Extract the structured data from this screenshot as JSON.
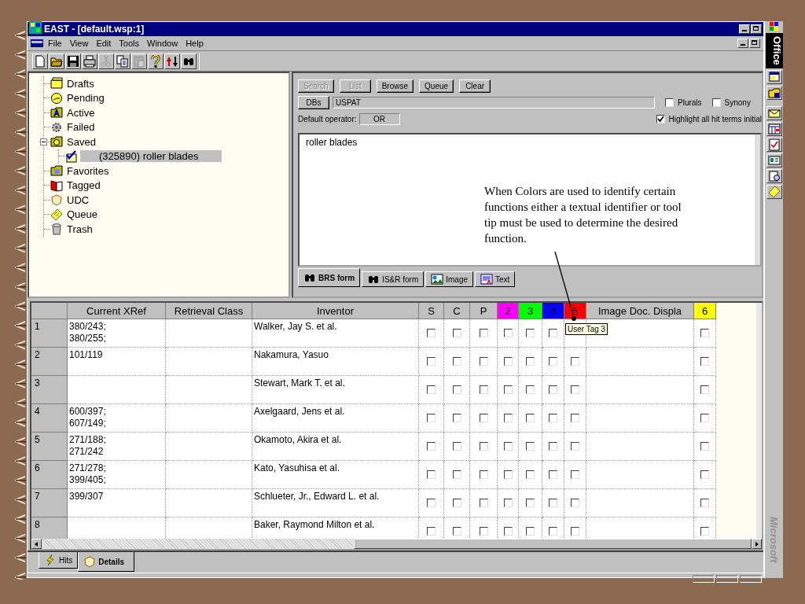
{
  "window": {
    "title": "EAST - [default.wsp:1]"
  },
  "menu": [
    "File",
    "View",
    "Edit",
    "Tools",
    "Window",
    "Help"
  ],
  "toolbar": [
    {
      "kind": "new",
      "disabled": false
    },
    {
      "kind": "open",
      "disabled": false
    },
    {
      "kind": "save",
      "disabled": false
    },
    {
      "kind": "print",
      "disabled": false
    },
    {
      "kind": "cut",
      "disabled": true
    },
    {
      "kind": "copy",
      "disabled": false
    },
    {
      "kind": "paste",
      "disabled": true
    },
    {
      "kind": "help",
      "disabled": false
    },
    {
      "kind": "sort",
      "disabled": false
    },
    {
      "kind": "find",
      "disabled": false
    }
  ],
  "tree": [
    {
      "label": "Drafts",
      "kind": "drafts",
      "selected": false
    },
    {
      "label": "Pending",
      "kind": "pending",
      "selected": false
    },
    {
      "label": "Active",
      "kind": "active",
      "selected": false
    },
    {
      "label": "Failed",
      "kind": "failed",
      "selected": false
    },
    {
      "label": "Saved",
      "kind": "saved",
      "selected": false,
      "expanded": true,
      "children": [
        {
          "label": "(325890) roller blades",
          "kind": "query",
          "selected": true
        }
      ]
    },
    {
      "label": "Favorites",
      "kind": "favorites",
      "selected": false
    },
    {
      "label": "Tagged",
      "kind": "tagged",
      "selected": false
    },
    {
      "label": "UDC",
      "kind": "udc",
      "selected": false
    },
    {
      "label": "Queue",
      "kind": "queue",
      "selected": false
    },
    {
      "label": "Trash",
      "kind": "trash",
      "selected": false
    }
  ],
  "query": {
    "buttons": [
      {
        "label": "Search",
        "disabled": true
      },
      {
        "label": "List",
        "disabled": true
      },
      {
        "label": "Browse",
        "disabled": false
      },
      {
        "label": "Queue",
        "disabled": false
      },
      {
        "label": "Clear",
        "disabled": false
      }
    ],
    "dbs_button": "DBs",
    "dbs_value": "USPAT",
    "options": [
      {
        "label": "Plurals",
        "checked": false
      },
      {
        "label": "Synony",
        "checked": false
      },
      {
        "label": "Highlight all hit terms initial",
        "checked": true
      }
    ],
    "operator_label": "Default operator:",
    "operator_value": "OR",
    "text": "roller blades",
    "tabs": [
      {
        "label": "BRS form",
        "kind": "binoculars",
        "selected": true
      },
      {
        "label": "IS&R form",
        "kind": "binoculars",
        "selected": false
      },
      {
        "label": "Image",
        "kind": "image",
        "selected": false
      },
      {
        "label": "Text",
        "kind": "text",
        "selected": false
      }
    ]
  },
  "annotation": {
    "text": "When Colors are used to identify certain functions either a textual identifier or tool tip must be used to determine the desired function."
  },
  "table": {
    "columns": [
      {
        "label": "Current XRef",
        "kind": "text"
      },
      {
        "label": "Retrieval Class",
        "kind": "text"
      },
      {
        "label": "Inventor",
        "kind": "text"
      },
      {
        "label": "S",
        "kind": "check"
      },
      {
        "label": "C",
        "kind": "check"
      },
      {
        "label": "P",
        "kind": "check"
      },
      {
        "label": "2",
        "kind": "check",
        "color": "#ff00ff"
      },
      {
        "label": "3",
        "kind": "check",
        "color": "#00ff00"
      },
      {
        "label": "4",
        "kind": "check",
        "color": "#0000ff"
      },
      {
        "label": "5",
        "kind": "check",
        "color": "#ff0000"
      },
      {
        "label": "Image Doc. Displa",
        "kind": "text"
      },
      {
        "label": "6",
        "kind": "check",
        "color": "#ffff00"
      }
    ],
    "rows": [
      {
        "number": "1",
        "cells": [
          "380/243;\n380/255;",
          null,
          "Walker, Jay S. et al.",
          {
            "checked": false
          },
          {
            "checked": false
          },
          {
            "checked": false
          },
          {
            "checked": false
          },
          {
            "checked": false
          },
          {
            "checked": false
          },
          null,
          null,
          {
            "checked": false
          }
        ]
      },
      {
        "number": "2",
        "cells": [
          "101/119",
          null,
          "Nakamura, Yasuo",
          {
            "checked": false
          },
          {
            "checked": false
          },
          {
            "checked": false
          },
          {
            "checked": false
          },
          {
            "checked": false
          },
          {
            "checked": false
          },
          {
            "checked": false
          },
          null,
          {
            "checked": false
          }
        ]
      },
      {
        "number": "3",
        "cells": [
          null,
          null,
          "Stewart, Mark T. et al.",
          {
            "checked": false
          },
          {
            "checked": false
          },
          {
            "checked": false
          },
          {
            "checked": false
          },
          {
            "checked": false
          },
          {
            "checked": false
          },
          {
            "checked": false
          },
          null,
          {
            "checked": false
          }
        ]
      },
      {
        "number": "4",
        "cells": [
          "600/397;\n607/149;",
          null,
          "Axelgaard, Jens et al.",
          {
            "checked": false
          },
          {
            "checked": false
          },
          {
            "checked": false
          },
          {
            "checked": false
          },
          {
            "checked": false
          },
          {
            "checked": false
          },
          {
            "checked": false
          },
          null,
          {
            "checked": false
          }
        ]
      },
      {
        "number": "5",
        "cells": [
          "271/188;\n271/242",
          null,
          "Okamoto, Akira et al.",
          {
            "checked": false
          },
          {
            "checked": false
          },
          {
            "checked": false
          },
          {
            "checked": false
          },
          {
            "checked": false
          },
          {
            "checked": false
          },
          {
            "checked": false
          },
          null,
          {
            "checked": false
          }
        ]
      },
      {
        "number": "6",
        "cells": [
          "271/278;\n399/405;",
          null,
          "Kato, Yasuhisa et al.",
          {
            "checked": false
          },
          {
            "checked": false
          },
          {
            "checked": false
          },
          {
            "checked": false
          },
          {
            "checked": false
          },
          {
            "checked": false
          },
          {
            "checked": false
          },
          null,
          {
            "checked": false
          }
        ]
      },
      {
        "number": "7",
        "cells": [
          "399/307",
          null,
          "Schlueter, Jr., Edward L. et al.",
          {
            "checked": false
          },
          {
            "checked": false
          },
          {
            "checked": false
          },
          {
            "checked": false
          },
          {
            "checked": false
          },
          {
            "checked": false
          },
          {
            "checked": false
          },
          null,
          {
            "checked": false
          }
        ]
      },
      {
        "number": "8",
        "cells": [
          null,
          null,
          "Baker, Raymond Milton et al.",
          {
            "checked": false
          },
          {
            "checked": false
          },
          {
            "checked": false
          },
          {
            "checked": false
          },
          {
            "checked": false
          },
          {
            "checked": false
          },
          {
            "checked": false
          },
          null,
          {
            "checked": false
          }
        ]
      }
    ]
  },
  "tooltip": {
    "text": "User Tag 3"
  },
  "bottom_tabs": [
    {
      "label": "Hits",
      "kind": "hits",
      "selected": false
    },
    {
      "label": "Details",
      "kind": "details",
      "selected": true
    }
  ],
  "office_bar": {
    "title": "Office",
    "brand": "Microsoft"
  }
}
